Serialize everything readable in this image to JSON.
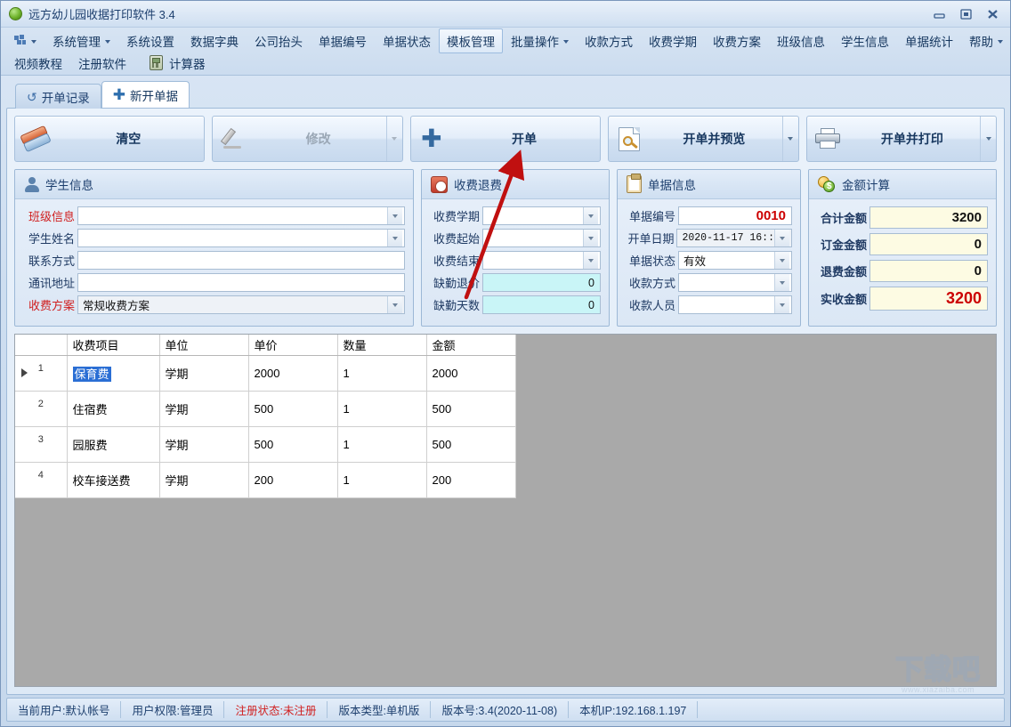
{
  "window": {
    "title": "远方幼儿园收据打印软件  3.4",
    "app_icon": "green-circle-icon",
    "buttons": {
      "minimize": "minimize-icon",
      "maximize": "maximize-icon",
      "close": "close-icon"
    }
  },
  "menubar": {
    "row1": [
      {
        "label": "",
        "icon": "grid-icon",
        "caret": true
      },
      {
        "label": "系统管理",
        "caret": true
      },
      {
        "label": "系统设置",
        "caret": false
      },
      {
        "label": "数据字典",
        "caret": false
      },
      {
        "label": "公司抬头",
        "caret": false
      },
      {
        "label": "单据编号",
        "caret": false
      },
      {
        "label": "单据状态",
        "caret": false
      },
      {
        "label": "模板管理",
        "caret": false,
        "selected": true
      },
      {
        "label": "批量操作",
        "caret": true
      },
      {
        "label": "收款方式",
        "caret": false
      },
      {
        "label": "收费学期",
        "caret": false
      },
      {
        "label": "收费方案",
        "caret": false
      },
      {
        "label": "班级信息",
        "caret": false
      },
      {
        "label": "学生信息",
        "caret": false
      },
      {
        "label": "单据统计",
        "caret": false
      },
      {
        "label": "帮助",
        "caret": true
      }
    ],
    "row2": [
      {
        "label": "视频教程",
        "icon": ""
      },
      {
        "label": "注册软件",
        "icon": ""
      },
      {
        "label": "计算器",
        "icon": "calculator-icon"
      }
    ]
  },
  "tabs": [
    {
      "label": "开单记录",
      "icon": "history-icon",
      "active": false
    },
    {
      "label": "新开单据",
      "icon": "plus-icon",
      "active": true
    }
  ],
  "toolbar": [
    {
      "label": "清空",
      "icon": "eraser-icon",
      "disabled": false,
      "split": false
    },
    {
      "label": "修改",
      "icon": "pencil-icon",
      "disabled": true,
      "split": true
    },
    {
      "label": "开单",
      "icon": "plus-icon",
      "disabled": false,
      "split": false
    },
    {
      "label": "开单并预览",
      "icon": "preview-icon",
      "disabled": false,
      "split": true
    },
    {
      "label": "开单并打印",
      "icon": "printer-icon",
      "disabled": false,
      "split": true
    }
  ],
  "panels": {
    "student": {
      "title": "学生信息",
      "icon": "user-icon",
      "fields": [
        {
          "label": "班级信息",
          "value": "",
          "required": true,
          "dropdown": true,
          "style": "white"
        },
        {
          "label": "学生姓名",
          "value": "",
          "required": false,
          "dropdown": true,
          "style": "white"
        },
        {
          "label": "联系方式",
          "value": "",
          "required": false,
          "dropdown": false,
          "style": "white"
        },
        {
          "label": "通讯地址",
          "value": "",
          "required": false,
          "dropdown": false,
          "style": "white"
        },
        {
          "label": "收费方案",
          "value": "常规收费方案",
          "required": true,
          "dropdown": true,
          "style": "grayish"
        }
      ]
    },
    "fee": {
      "title": "收费退费",
      "icon": "clock-icon",
      "fields": [
        {
          "label": "收费学期",
          "value": "",
          "required": false,
          "dropdown": true,
          "style": "white"
        },
        {
          "label": "收费起始",
          "value": "",
          "required": false,
          "dropdown": true,
          "style": "white"
        },
        {
          "label": "收费结束",
          "value": "",
          "required": false,
          "dropdown": true,
          "style": "white"
        },
        {
          "label": "缺勤退价",
          "value": "0",
          "required": false,
          "dropdown": false,
          "style": "cyan",
          "align": "right"
        },
        {
          "label": "缺勤天数",
          "value": "0",
          "required": false,
          "dropdown": false,
          "style": "cyan",
          "align": "right"
        }
      ]
    },
    "doc": {
      "title": "单据信息",
      "icon": "clipboard-icon",
      "fields": [
        {
          "label": "单据编号",
          "value": "0010",
          "required": false,
          "dropdown": false,
          "style": "white",
          "align": "right",
          "color": "red"
        },
        {
          "label": "开单日期",
          "value": "2020-11-17  16::",
          "required": false,
          "dropdown": true,
          "style": "grayish"
        },
        {
          "label": "单据状态",
          "value": "有效",
          "required": false,
          "dropdown": true,
          "style": "white"
        },
        {
          "label": "收款方式",
          "value": "",
          "required": false,
          "dropdown": true,
          "style": "white"
        },
        {
          "label": "收款人员",
          "value": "",
          "required": false,
          "dropdown": true,
          "style": "white"
        }
      ]
    },
    "amount": {
      "title": "金额计算",
      "icon": "coins-icon",
      "fields": [
        {
          "label": "合计金额",
          "value": "3200",
          "required": false,
          "dropdown": false,
          "style": "cream",
          "align": "right",
          "color": "big"
        },
        {
          "label": "订金金额",
          "value": "0",
          "required": false,
          "dropdown": false,
          "style": "cream",
          "align": "right",
          "color": "big"
        },
        {
          "label": "退费金额",
          "value": "0",
          "required": false,
          "dropdown": false,
          "style": "cream",
          "align": "right",
          "color": "big"
        },
        {
          "label": "实收金额",
          "value": "3200",
          "required": false,
          "dropdown": false,
          "style": "cream",
          "align": "right",
          "color": "red"
        }
      ]
    }
  },
  "grid": {
    "columns": [
      "收费项目",
      "单位",
      "单价",
      "数量",
      "金额"
    ],
    "rows": [
      {
        "n": "1",
        "current": true,
        "cells": [
          "保育费",
          "学期",
          "2000",
          "1",
          "2000"
        ],
        "selected_cell": 0
      },
      {
        "n": "2",
        "current": false,
        "cells": [
          "住宿费",
          "学期",
          "500",
          "1",
          "500"
        ]
      },
      {
        "n": "3",
        "current": false,
        "cells": [
          "园服费",
          "学期",
          "500",
          "1",
          "500"
        ]
      },
      {
        "n": "4",
        "current": false,
        "cells": [
          "校车接送费",
          "学期",
          "200",
          "1",
          "200"
        ]
      }
    ]
  },
  "statusbar": [
    {
      "text": "当前用户:默认帐号",
      "red": false
    },
    {
      "text": "用户权限:管理员",
      "red": false
    },
    {
      "text": "注册状态:未注册",
      "red": true
    },
    {
      "text": "版本类型:单机版",
      "red": false
    },
    {
      "text": "版本号:3.4(2020-11-08)",
      "red": false
    },
    {
      "text": "本机IP:192.168.1.197",
      "red": false
    }
  ],
  "watermark": {
    "text": "下载吧",
    "sub": "www.xiazaiba.com"
  },
  "annotation": {
    "type": "red-arrow",
    "color": "#c01010"
  }
}
